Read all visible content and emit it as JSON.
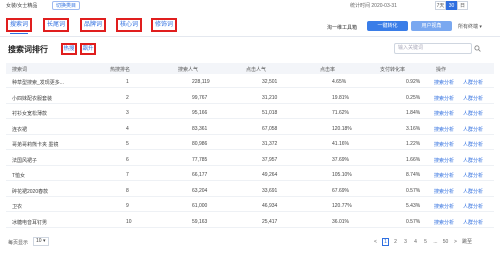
{
  "topbar": {
    "breadcrumb": "女装/女士精品",
    "switch_label": "切换类目",
    "period_text": "统计时间 2020-03-31",
    "timeframes": [
      {
        "label": "7天",
        "active": false
      },
      {
        "label": "30天",
        "active": true
      },
      {
        "label": "日",
        "active": false
      }
    ]
  },
  "nav": {
    "tabs": [
      "搜索词",
      "长尾词",
      "品牌词",
      "核心词",
      "修饰词"
    ],
    "right_text": "淘一维工具箱",
    "btn_primary": "一键转化",
    "btn_secondary": "用户视角",
    "select_label": "所有终端"
  },
  "section": {
    "title": "搜索词排行",
    "sub_tabs": [
      "热搜",
      "飙升"
    ],
    "search_placeholder": "输入关键词"
  },
  "table": {
    "headers": [
      "搜索词",
      "热搜排名",
      "搜索人气",
      "点击人气",
      "点击率",
      "支付转化率",
      "操作"
    ],
    "rows": [
      {
        "term": "种草型搜索_发现更多...",
        "rank": "1",
        "search_pop": "228,119",
        "click_pop": "32,501",
        "ctr": "4.65%",
        "conv": "0.92%",
        "a1": "搜索分析",
        "a2": "人群分析"
      },
      {
        "term": "小四妹配衣服套装",
        "rank": "2",
        "search_pop": "99,767",
        "click_pop": "31,210",
        "ctr": "19.81%",
        "conv": "0.25%",
        "a1": "搜索分析",
        "a2": "人群分析"
      },
      {
        "term": "衬衫女宽松薄款",
        "rank": "3",
        "search_pop": "95,166",
        "click_pop": "51,018",
        "ctr": "71.62%",
        "conv": "1.84%",
        "a1": "搜索分析",
        "a2": "人群分析"
      },
      {
        "term": "连衣裙",
        "rank": "4",
        "search_pop": "83,361",
        "click_pop": "67,058",
        "ctr": "120.18%",
        "conv": "3.16%",
        "a1": "搜索分析",
        "a2": "人群分析"
      },
      {
        "term": "哥弟哥莉熊卡夹 墨镜",
        "rank": "5",
        "search_pop": "80,986",
        "click_pop": "31,372",
        "ctr": "41.16%",
        "conv": "1.22%",
        "a1": "搜索分析",
        "a2": "人群分析"
      },
      {
        "term": "法国风裙子",
        "rank": "6",
        "search_pop": "77,785",
        "click_pop": "37,957",
        "ctr": "37.69%",
        "conv": "1.66%",
        "a1": "搜索分析",
        "a2": "人群分析"
      },
      {
        "term": "T恤女",
        "rank": "7",
        "search_pop": "66,177",
        "click_pop": "49,264",
        "ctr": "105.10%",
        "conv": "8.74%",
        "a1": "搜索分析",
        "a2": "人群分析"
      },
      {
        "term": "碎花裙2020春款",
        "rank": "8",
        "search_pop": "63,204",
        "click_pop": "33,691",
        "ctr": "67.69%",
        "conv": "0.57%",
        "a1": "搜索分析",
        "a2": "人群分析"
      },
      {
        "term": "卫衣",
        "rank": "9",
        "search_pop": "61,000",
        "click_pop": "46,934",
        "ctr": "120.77%",
        "conv": "5.43%",
        "a1": "搜索分析",
        "a2": "人群分析"
      },
      {
        "term": "冰糖电音耳钉男",
        "rank": "10",
        "search_pop": "59,163",
        "click_pop": "25,417",
        "ctr": "36.01%",
        "conv": "0.57%",
        "a1": "搜索分析",
        "a2": "人群分析"
      }
    ]
  },
  "footer": {
    "page_size_label": "每页显示",
    "page_size_value": "10",
    "prev": "<",
    "pages": [
      "1",
      "2",
      "3",
      "4",
      "5",
      "...",
      "50"
    ],
    "next": ">",
    "goto_label": "跳至"
  }
}
